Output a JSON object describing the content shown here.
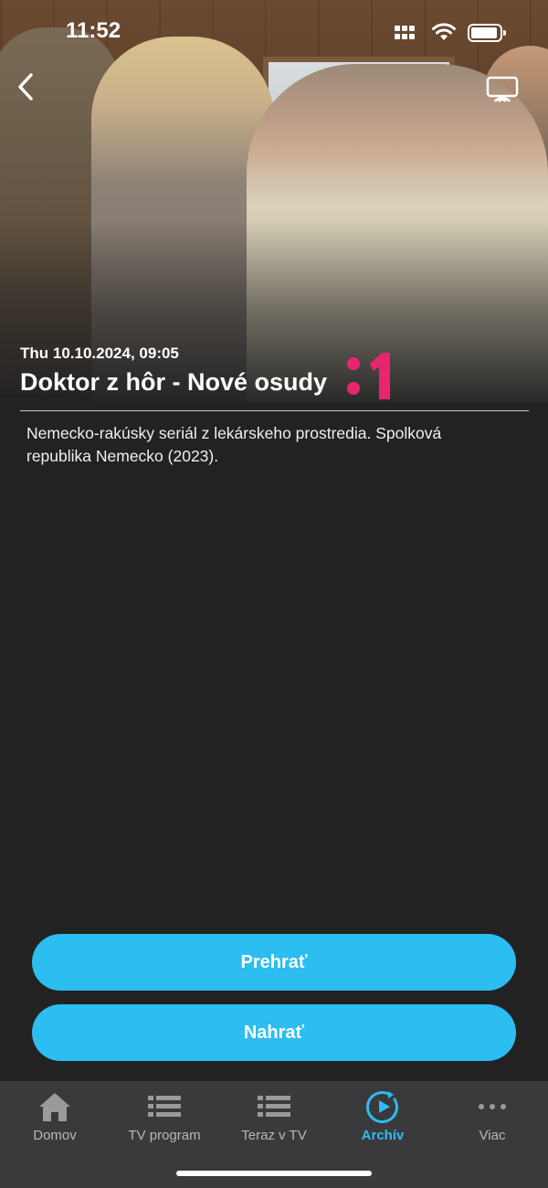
{
  "status_bar": {
    "time": "11:52"
  },
  "program": {
    "airdate": "Thu 10.10.2024, 09:05",
    "title": "Doktor z hôr - Nové osudy",
    "channel_logo_text": ":1",
    "description": "Nemecko-rakúsky seriál z lekárskeho prostredia. Spolková republika Nemecko (2023)."
  },
  "actions": {
    "play_label": "Prehrať",
    "record_label": "Nahrať"
  },
  "tabbar": {
    "items": [
      {
        "label": "Domov",
        "icon": "home-icon"
      },
      {
        "label": "TV program",
        "icon": "list-icon"
      },
      {
        "label": "Teraz v TV",
        "icon": "list-icon"
      },
      {
        "label": "Archív",
        "icon": "archive-play-icon",
        "active": true
      },
      {
        "label": "Viac",
        "icon": "more-icon"
      }
    ]
  },
  "colors": {
    "accent": "#2cbdf1",
    "background": "#222223",
    "tabbar": "#3a3a3c",
    "channel_logo": "#e8256f"
  }
}
